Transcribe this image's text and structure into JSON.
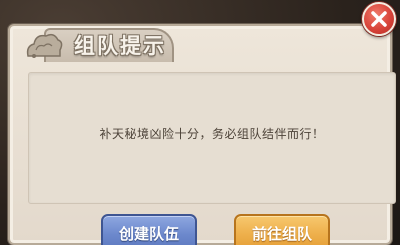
{
  "dialog": {
    "title": "组队提示",
    "message": "补天秘境凶险十分，务必组队结伴而行！",
    "buttons": {
      "create_team": "创建队伍",
      "go_to_team": "前往组队"
    }
  },
  "icons": {
    "close": "close-icon",
    "title_ornament": "cloud-ornament-icon"
  },
  "colors": {
    "panel": "#e3d9cc",
    "create_button": "#6d89cd",
    "go_button": "#eeb04c",
    "close_button": "#d8443a"
  }
}
